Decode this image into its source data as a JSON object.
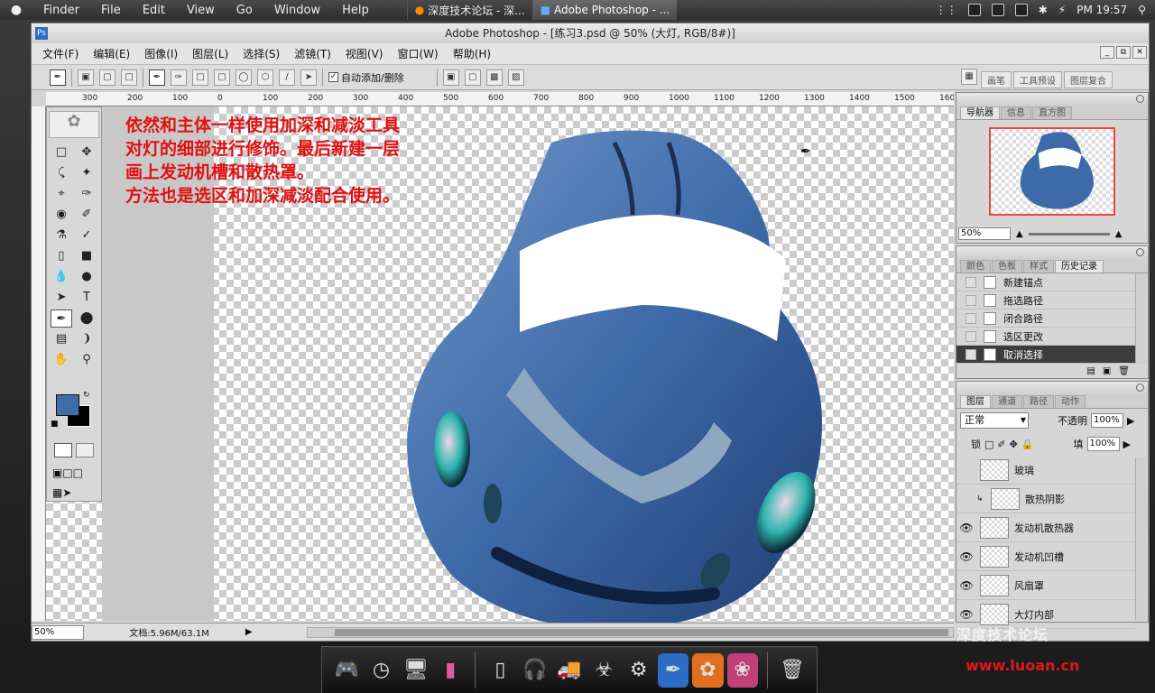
{
  "menubar": {
    "apple": "",
    "items": [
      "Finder",
      "File",
      "Edit",
      "View",
      "Go",
      "Window",
      "Help"
    ],
    "tabs": [
      {
        "label": "深度技术论坛 - 深...",
        "active": false
      },
      {
        "label": "Adobe Photoshop - ...",
        "active": true
      }
    ],
    "clock": "PM 19:57"
  },
  "window": {
    "title": "Adobe Photoshop - [练习3.psd @ 50% (大灯, RGB/8#)]",
    "menu": [
      "文件(F)",
      "编辑(E)",
      "图像(I)",
      "图层(L)",
      "选择(S)",
      "滤镜(T)",
      "视图(V)",
      "窗口(W)",
      "帮助(H)"
    ]
  },
  "options": {
    "auto_add_delete": "自动添加/删除",
    "dock_tabs": [
      "画笔",
      "工具预设",
      "图层复合"
    ]
  },
  "ruler": {
    "ticks": [
      "300",
      "200",
      "100",
      "0",
      "100",
      "200",
      "300",
      "400",
      "500",
      "600",
      "700",
      "800",
      "900",
      "1000",
      "1100",
      "1200",
      "1300",
      "1400",
      "1500",
      "160"
    ]
  },
  "annotation": {
    "line1": "依然和主体一样使用加深和减淡工具",
    "line2": "对灯的细部进行修饰。最后新建一层",
    "line3": "画上发动机槽和散热罩。",
    "line4": "方法也是选区和加深减淡配合使用。"
  },
  "colors": {
    "foreground": "#3e6ea8",
    "background": "#000000",
    "annotation": "#e21010"
  },
  "status": {
    "zoom": "50%",
    "doc": "文档:5.96M/63.1M"
  },
  "navigator": {
    "tabs": [
      "导航器",
      "信息",
      "直方图"
    ],
    "zoom": "50%"
  },
  "history": {
    "tabs": [
      "颜色",
      "色板",
      "样式",
      "历史记录"
    ],
    "items": [
      {
        "label": "新建锚点",
        "selected": false
      },
      {
        "label": "拖选路径",
        "selected": false
      },
      {
        "label": "闭合路径",
        "selected": false
      },
      {
        "label": "选区更改",
        "selected": false
      },
      {
        "label": "取消选择",
        "selected": true
      }
    ]
  },
  "layers": {
    "tabs": [
      "图层",
      "通道",
      "路径",
      "动作"
    ],
    "blend": "正常",
    "opacity_label": "不透明",
    "opacity": "100%",
    "lock_label": "锁",
    "fill_label": "填",
    "fill": "100%",
    "items": [
      {
        "name": "玻璃",
        "visible": false,
        "indent": false
      },
      {
        "name": "散热阴影",
        "visible": false,
        "indent": true
      },
      {
        "name": "发动机散热器",
        "visible": true,
        "indent": false
      },
      {
        "name": "发动机凹槽",
        "visible": true,
        "indent": false
      },
      {
        "name": "风扇罩",
        "visible": true,
        "indent": false
      },
      {
        "name": "大灯内部",
        "visible": true,
        "indent": false
      }
    ]
  },
  "watermark": {
    "logo": "深度技术论坛",
    "url": "www.luoan.cn"
  }
}
